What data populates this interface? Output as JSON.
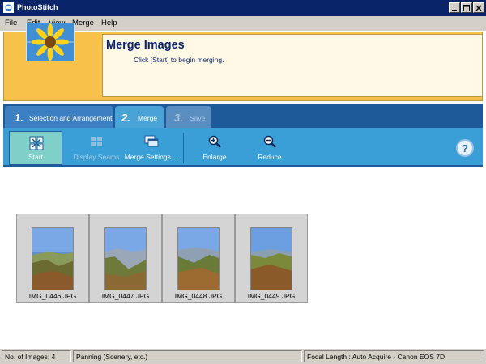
{
  "window": {
    "title": "PhotoStitch"
  },
  "menu": [
    "File",
    "Edit",
    "View",
    "Merge",
    "Help"
  ],
  "header": {
    "title": "Merge Images",
    "subtitle": "Click [Start] to begin merging."
  },
  "tabs": [
    {
      "number": "1.",
      "label": "Selection and Arrangement"
    },
    {
      "number": "2.",
      "label": "Merge"
    },
    {
      "number": "3.",
      "label": "Save"
    }
  ],
  "toolbar": {
    "start": "Start",
    "display_seams": "Display Seams",
    "merge_settings": "Merge Settings ...",
    "enlarge": "Enlarge",
    "reduce": "Reduce",
    "help": "?"
  },
  "images": [
    "IMG_0446.JPG",
    "IMG_0447.JPG",
    "IMG_0448.JPG",
    "IMG_0449.JPG"
  ],
  "status": {
    "count": "No. of Images: 4",
    "mode": "Panning (Scenery, etc.)",
    "focal": "Focal Length : Auto Acquire - Canon EOS 7D"
  },
  "colors": {
    "titlebar": "#0a246a",
    "banner": "#f7c14a",
    "tabstrip": "#1e5a9a",
    "toolbar": "#3a9fd6"
  }
}
